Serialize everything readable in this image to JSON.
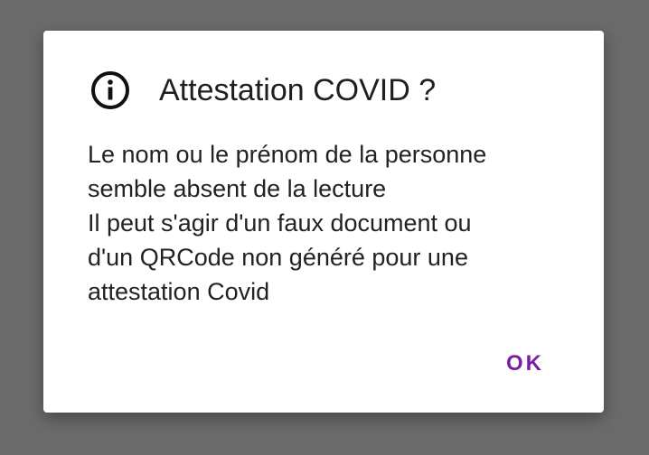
{
  "dialog": {
    "title": "Attestation COVID ?",
    "icon": "info-circle-icon",
    "message_lines": [
      "Le nom ou le prénom de la personne",
      "semble absent de la lecture",
      "Il peut s'agir d'un faux document ou",
      "d'un QRCode non généré pour une",
      "attestation Covid"
    ],
    "ok_label": "OK"
  },
  "colors": {
    "backdrop": "#6b6b6b",
    "dialog_background": "#ffffff",
    "text": "#222222",
    "accent": "#7b1fa2"
  }
}
